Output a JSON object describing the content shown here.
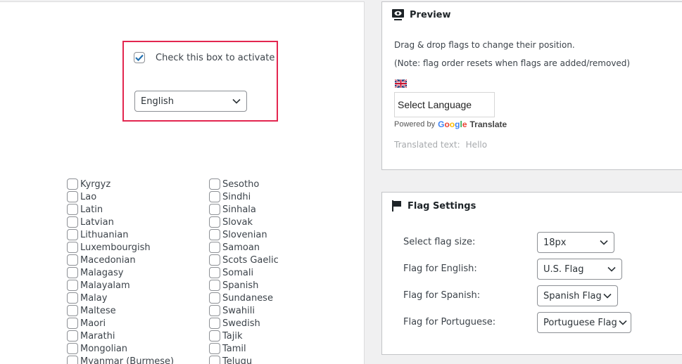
{
  "activation": {
    "checkbox_label": "Check this box to activate",
    "checked": true,
    "language_select_value": "English"
  },
  "languages": {
    "column1": [
      "Kyrgyz",
      "Lao",
      "Latin",
      "Latvian",
      "Lithuanian",
      "Luxembourgish",
      "Macedonian",
      "Malagasy",
      "Malayalam",
      "Malay",
      "Maltese",
      "Maori",
      "Marathi",
      "Mongolian",
      "Myanmar (Burmese)"
    ],
    "column2": [
      "Sesotho",
      "Sindhi",
      "Sinhala",
      "Slovak",
      "Slovenian",
      "Samoan",
      "Scots Gaelic",
      "Somali",
      "Spanish",
      "Sundanese",
      "Swahili",
      "Swedish",
      "Tajik",
      "Tamil",
      "Telugu"
    ]
  },
  "preview": {
    "title": "Preview",
    "icon": "preview-eye-icon",
    "instructions": "Drag & drop flags to change their position.",
    "note": "(Note: flag order resets when flags are added/removed)",
    "flag": "uk-flag",
    "select_language": "Select Language",
    "powered_by": "Powered by",
    "google_letters": [
      "G",
      "o",
      "o",
      "g",
      "l",
      "e"
    ],
    "google_colors": [
      "#4285f4",
      "#ea4335",
      "#fbbc05",
      "#4285f4",
      "#34a853",
      "#ea4335"
    ],
    "translate": "Translate",
    "translated_label": "Translated text:",
    "translated_value": "Hello"
  },
  "flag_settings": {
    "title": "Flag Settings",
    "icon": "flag-icon",
    "rows": [
      {
        "label": "Select flag size:",
        "value": "18px"
      },
      {
        "label": "Flag for English:",
        "value": "U.S. Flag"
      },
      {
        "label": "Flag for Spanish:",
        "value": "Spanish Flag"
      },
      {
        "label": "Flag for Portuguese:",
        "value": "Portuguese Flag"
      }
    ]
  },
  "colors": {
    "highlight_border": "#e3264f",
    "checkbox_check": "#2271b1"
  }
}
